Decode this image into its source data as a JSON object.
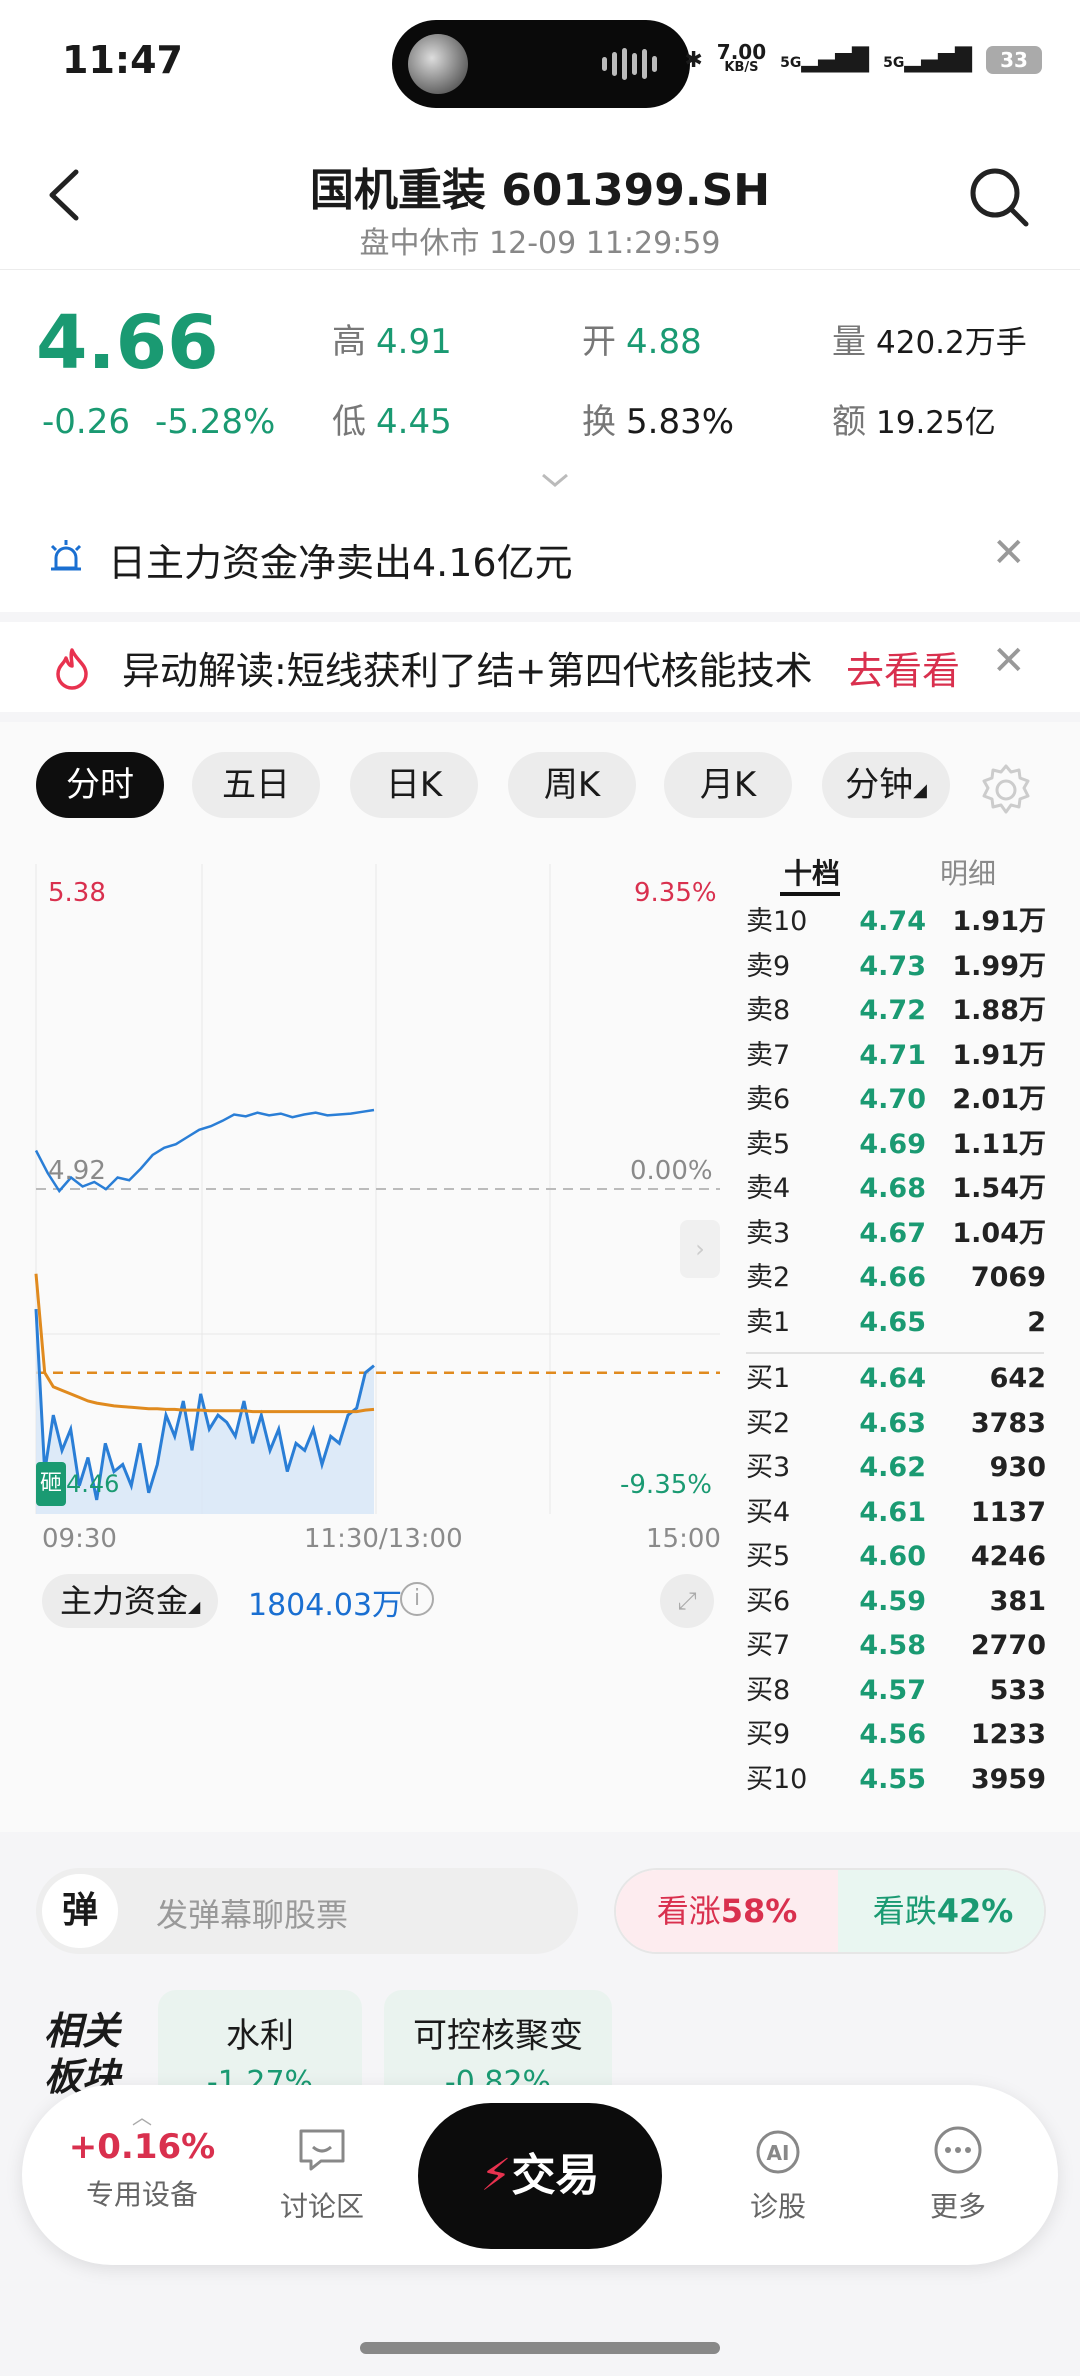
{
  "status_bar": {
    "time": "11:47",
    "net_speed": "7.00",
    "net_unit": "KB/S",
    "signal1": "5G",
    "signal2": "5G",
    "battery": "33"
  },
  "header": {
    "title": "国机重装 601399.SH",
    "subtitle": "盘中休市 12-09 11:29:59"
  },
  "quote": {
    "price": "4.66",
    "change": "-0.26",
    "change_pct": "-5.28%",
    "high_label": "高",
    "high": "4.91",
    "low_label": "低",
    "low": "4.45",
    "open_label": "开",
    "open": "4.88",
    "turnover_label": "换",
    "turnover": "5.83%",
    "volume_label": "量",
    "volume": "420.2万手",
    "amount_label": "额",
    "amount": "19.25亿"
  },
  "banners": {
    "fund_flow": "日主力资金净卖出4.16亿元",
    "anomaly": "异动解读:短线获利了结+第四代核能技术",
    "anomaly_link": "去看看"
  },
  "chart_tabs": [
    "分时",
    "五日",
    "日K",
    "周K",
    "月K",
    "分钟"
  ],
  "chart_labels": {
    "top_price": "5.38",
    "top_pct": "9.35%",
    "mid_price": "4.92",
    "mid_pct": "0.00%",
    "bottom_price": "4.46",
    "bottom_pct": "-9.35%",
    "badge": "砸",
    "time_start": "09:30",
    "time_mid": "11:30/13:00",
    "time_end": "15:00",
    "fund_selector": "主力资金",
    "fund_value": "1804.03万"
  },
  "chart_data": {
    "type": "line",
    "title": "",
    "xlabel": "",
    "ylabel": "",
    "ylim": [
      4.46,
      5.38
    ],
    "x_ticks": [
      "09:30",
      "11:30/13:00",
      "15:00"
    ],
    "prev_close": 4.92,
    "series": [
      {
        "values": [
          4.75,
          4.52,
          4.6,
          4.55,
          4.58,
          4.5,
          4.54,
          4.48,
          4.56,
          4.52,
          4.53,
          4.5,
          4.56,
          4.49,
          4.53,
          4.6,
          4.57,
          4.62,
          4.55,
          4.63,
          4.58,
          4.6,
          4.59,
          4.57,
          4.62,
          4.56,
          4.6,
          4.55,
          4.58,
          4.52,
          4.56,
          4.55,
          4.58,
          4.53,
          4.57,
          4.56,
          4.6,
          4.61,
          4.66,
          4.67
        ]
      },
      {
        "values": [
          4.8,
          4.66,
          4.64,
          4.635,
          4.63,
          4.625,
          4.62,
          4.617,
          4.615,
          4.613,
          4.612,
          4.611,
          4.61,
          4.609,
          4.609,
          4.608,
          4.608,
          4.607,
          4.607,
          4.607,
          4.606,
          4.606,
          4.606,
          4.606,
          4.606,
          4.605,
          4.605,
          4.605,
          4.605,
          4.605,
          4.605,
          4.605,
          4.605,
          4.605,
          4.605,
          4.605,
          4.605,
          4.605,
          4.607,
          4.608
        ]
      }
    ],
    "current_price_line": 4.66
  },
  "fund_flow_chart": {
    "type": "line",
    "values": [
      0.55,
      0.3,
      0.1,
      0.25,
      0.15,
      0.2,
      0.12,
      0.25,
      0.22,
      0.35,
      0.5,
      0.58,
      0.62,
      0.7,
      0.78,
      0.82,
      0.88,
      0.95,
      0.93,
      0.97,
      0.94,
      0.96,
      0.92,
      0.95,
      0.97,
      0.94,
      0.95,
      0.96,
      0.98,
      1.0
    ]
  },
  "order_book": {
    "tab_active": "十档",
    "tab_inactive": "明细",
    "asks": [
      {
        "label": "卖10",
        "price": "4.74",
        "vol": "1.91万"
      },
      {
        "label": "卖9",
        "price": "4.73",
        "vol": "1.99万"
      },
      {
        "label": "卖8",
        "price": "4.72",
        "vol": "1.88万"
      },
      {
        "label": "卖7",
        "price": "4.71",
        "vol": "1.91万"
      },
      {
        "label": "卖6",
        "price": "4.70",
        "vol": "2.01万"
      },
      {
        "label": "卖5",
        "price": "4.69",
        "vol": "1.11万"
      },
      {
        "label": "卖4",
        "price": "4.68",
        "vol": "1.54万"
      },
      {
        "label": "卖3",
        "price": "4.67",
        "vol": "1.04万"
      },
      {
        "label": "卖2",
        "price": "4.66",
        "vol": "7069"
      },
      {
        "label": "卖1",
        "price": "4.65",
        "vol": "2"
      }
    ],
    "bids": [
      {
        "label": "买1",
        "price": "4.64",
        "vol": "642"
      },
      {
        "label": "买2",
        "price": "4.63",
        "vol": "3783"
      },
      {
        "label": "买3",
        "price": "4.62",
        "vol": "930"
      },
      {
        "label": "买4",
        "price": "4.61",
        "vol": "1137"
      },
      {
        "label": "买5",
        "price": "4.60",
        "vol": "4246"
      },
      {
        "label": "买6",
        "price": "4.59",
        "vol": "381"
      },
      {
        "label": "买7",
        "price": "4.58",
        "vol": "2770"
      },
      {
        "label": "买8",
        "price": "4.57",
        "vol": "533"
      },
      {
        "label": "买9",
        "price": "4.56",
        "vol": "1233"
      },
      {
        "label": "买10",
        "price": "4.55",
        "vol": "3959"
      }
    ]
  },
  "danmu": {
    "badge": "弹",
    "placeholder": "发弹幕聊股票"
  },
  "vote": {
    "up_label": "看涨",
    "up_pct": "58%",
    "down_label": "看跌",
    "down_pct": "42%"
  },
  "sectors": {
    "title": "相关板块",
    "items": [
      {
        "name": "水利",
        "pct": "-1.27%"
      },
      {
        "name": "可控核聚变",
        "pct": "-0.82%"
      }
    ]
  },
  "bottom_nav": {
    "index_value": "+0.16%",
    "device_label": "专用设备",
    "discuss_label": "讨论区",
    "trade_label": "交易",
    "diagnose_label": "诊股",
    "more_label": "更多"
  },
  "colors": {
    "up": "#d9304e",
    "down": "#1a9a72",
    "accent": "#1a6fd1",
    "avg_line": "#e08a1e"
  }
}
